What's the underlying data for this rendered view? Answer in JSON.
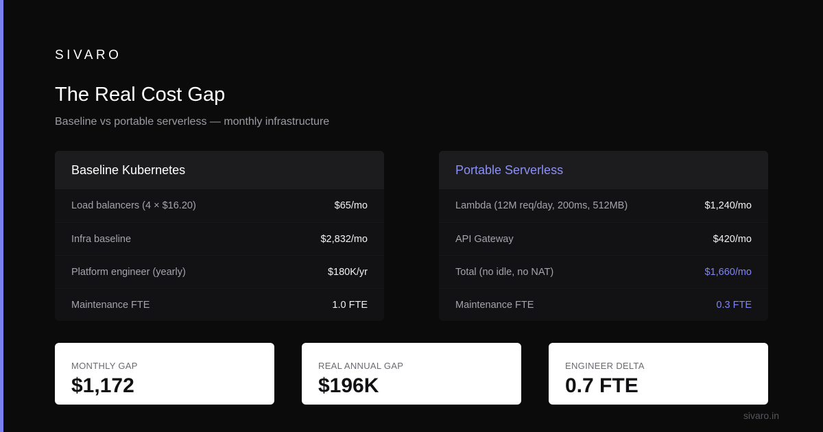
{
  "brand": "SIVARO",
  "title": "The Real Cost Gap",
  "subtitle": "Baseline vs portable serverless — monthly infrastructure",
  "colors": {
    "accent": "#7a80f0",
    "background": "#0b0b0c"
  },
  "baseline": {
    "heading": "Baseline Kubernetes",
    "rows": [
      {
        "label": "Load balancers (4 × $16.20)",
        "value": "$65/mo"
      },
      {
        "label": "Infra baseline",
        "value": "$2,832/mo"
      },
      {
        "label": "Platform engineer (yearly)",
        "value": "$180K/yr"
      },
      {
        "label": "Maintenance FTE",
        "value": "1.0 FTE"
      }
    ]
  },
  "serverless": {
    "heading": "Portable Serverless",
    "rows": [
      {
        "label": "Lambda (12M req/day, 200ms, 512MB)",
        "value": "$1,240/mo"
      },
      {
        "label": "API Gateway",
        "value": "$420/mo"
      },
      {
        "label": "Total (no idle, no NAT)",
        "value": "$1,660/mo"
      },
      {
        "label": "Maintenance FTE",
        "value": "0.3 FTE"
      }
    ]
  },
  "stats": [
    {
      "label": "MONTHLY GAP",
      "value": "$1,172"
    },
    {
      "label": "REAL ANNUAL GAP",
      "value": "$196K"
    },
    {
      "label": "ENGINEER DELTA",
      "value": "0.7 FTE"
    }
  ],
  "footer": "sivaro.in"
}
